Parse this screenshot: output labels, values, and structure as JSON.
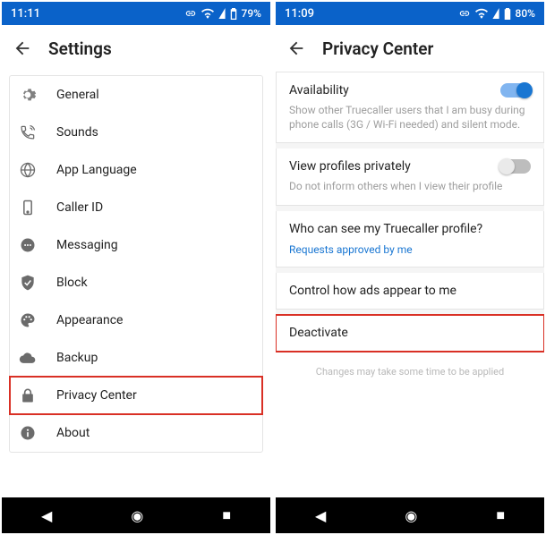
{
  "left": {
    "status": {
      "time": "11:11",
      "battery": "79%"
    },
    "title": "Settings",
    "menu": [
      {
        "label": "General"
      },
      {
        "label": "Sounds"
      },
      {
        "label": "App Language"
      },
      {
        "label": "Caller ID"
      },
      {
        "label": "Messaging"
      },
      {
        "label": "Block"
      },
      {
        "label": "Appearance"
      },
      {
        "label": "Backup"
      },
      {
        "label": "Privacy Center"
      },
      {
        "label": "About"
      }
    ]
  },
  "right": {
    "status": {
      "time": "11:09",
      "battery": "80%"
    },
    "title": "Privacy Center",
    "sections": {
      "availability": {
        "title": "Availability",
        "desc": "Show other Truecaller users that I am busy during phone calls (3G / Wi-Fi needed) and silent mode.",
        "on": true
      },
      "view_private": {
        "title": "View profiles privately",
        "desc": "Do not inform others when I view their profile",
        "on": false
      },
      "who_see": {
        "title": "Who can see my Truecaller profile?",
        "link": "Requests approved by me"
      },
      "ads": {
        "title": "Control how ads appear to me"
      },
      "deactivate": {
        "title": "Deactivate"
      }
    },
    "footnote": "Changes may take some time to be applied"
  }
}
